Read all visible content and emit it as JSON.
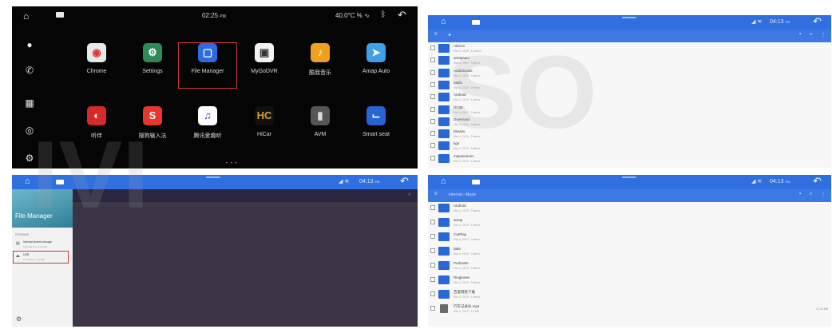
{
  "launcher": {
    "status": {
      "time": "02:25",
      "time_suffix": "PM",
      "temperature": "40.0°C",
      "extra": "% ∿"
    },
    "dock_icons": [
      "home-icon",
      "microphone-icon",
      "phone-icon",
      "apps-grid-icon",
      "navigation-icon",
      "settings-icon"
    ],
    "apps": [
      {
        "label": "Chrome",
        "icon": "chrome-icon",
        "color": "#e8e8e8",
        "glyph": "◉",
        "glyph_color": "#d33"
      },
      {
        "label": "Settings",
        "icon": "gear-icon",
        "color": "#2e8b57",
        "glyph": "⚙",
        "glyph_color": "#fff"
      },
      {
        "label": "File Manager",
        "icon": "file-manager-icon",
        "color": "#2d6cdf",
        "glyph": "▢",
        "glyph_color": "#fff"
      },
      {
        "label": "MyGoDVR",
        "icon": "dvr-icon",
        "color": "#f2f2f2",
        "glyph": "▣",
        "glyph_color": "#333"
      },
      {
        "label": "酷我音乐",
        "icon": "kuwo-music-icon",
        "color": "#f0a020",
        "glyph": "♪",
        "glyph_color": "#fff"
      },
      {
        "label": "Amap Auto",
        "icon": "amap-icon",
        "color": "#3fa0e8",
        "glyph": "➤",
        "glyph_color": "#fff"
      },
      {
        "label": "听伴",
        "icon": "tingban-icon",
        "color": "#d42a2a",
        "glyph": "◐",
        "glyph_color": "#fff"
      },
      {
        "label": "搜狗输入法",
        "icon": "sogou-input-icon",
        "color": "#e6362f",
        "glyph": "S",
        "glyph_color": "#fff"
      },
      {
        "label": "腾讯爱趣听",
        "icon": "tencent-listen-icon",
        "color": "#ffffff",
        "glyph": "♫",
        "glyph_color": "#5b2bb8"
      },
      {
        "label": "HiCar",
        "icon": "hicar-icon",
        "color": "#101010",
        "glyph": "HC",
        "glyph_color": "#d9a030"
      },
      {
        "label": "AVM",
        "icon": "avm-icon",
        "color": "#555",
        "glyph": "▮",
        "glyph_color": "#ddd"
      },
      {
        "label": "Smart seat",
        "icon": "smart-seat-icon",
        "color": "#2764d6",
        "glyph": "⌙",
        "glyph_color": "#fff"
      }
    ],
    "selected_app": "File Manager"
  },
  "window_chrome": {
    "time": "04:13",
    "time_suffix": "PM"
  },
  "file_list_top": {
    "rows": [
      {
        "name": "Alarms",
        "meta": "Mar 4, 2019 · 12 items"
      },
      {
        "name": "amapauto",
        "meta": "Mar 4, 2019 · 3 items"
      },
      {
        "name": "Audiobooks",
        "meta": "Mar 4, 2019 · 0 items"
      },
      {
        "name": "baidu",
        "meta": "Mar 4, 2019 · 2 items"
      },
      {
        "name": "Android",
        "meta": "Mar 4, 2019 · 1 items"
      },
      {
        "name": "DCIM",
        "meta": "Mar 4, 2019 · 0 items"
      },
      {
        "name": "Download",
        "meta": "Mar 4, 2019 · 0 items"
      },
      {
        "name": "Movies",
        "meta": "Mar 4, 2019 · 0 items"
      },
      {
        "name": "kgs",
        "meta": "Mar 4, 2019 · 5 items"
      },
      {
        "name": "mapversion1",
        "meta": "Mar 4, 2019 · 1 items"
      }
    ]
  },
  "file_list_bottom": {
    "path": "Internal › Music",
    "rows": [
      {
        "name": "Android",
        "meta": "Mar 4, 2019 · 2 items",
        "type": "folder"
      },
      {
        "name": "amap",
        "meta": "Mar 4, 2019 · 1 items",
        "type": "folder"
      },
      {
        "name": "CarPlay",
        "meta": "Mar 4, 2019 · 0 items",
        "type": "folder"
      },
      {
        "name": "data",
        "meta": "Mar 4, 2019 · 3 items",
        "type": "folder"
      },
      {
        "name": "Podcasts",
        "meta": "Mar 4, 2019 · 0 items",
        "type": "folder"
      },
      {
        "name": "Ringtones",
        "meta": "Mar 4, 2019 · 0 items",
        "type": "folder"
      },
      {
        "name": "百度网盘下载",
        "meta": "Mar 4, 2019 · 1 items",
        "type": "folder"
      },
      {
        "name": "行车记录仪.mp4",
        "meta": "Mar 4, 2019 · 12 MB",
        "type": "file",
        "size": "12.04 MB"
      }
    ]
  },
  "file_manager_drawer": {
    "title": "File Manager",
    "section": "STORAGE",
    "items": [
      {
        "title": "Internal shared storage",
        "sub": "12.6 GB free of 32 GB",
        "icon": "storage-icon"
      },
      {
        "title": "USB",
        "sub": "2.3 GB free of 8 GB",
        "icon": "usb-icon"
      }
    ]
  },
  "colors": {
    "accent": "#2f6fe0",
    "folder": "#2a67d6",
    "selection": "#d23a3a",
    "launcher_bg": "#050505"
  }
}
